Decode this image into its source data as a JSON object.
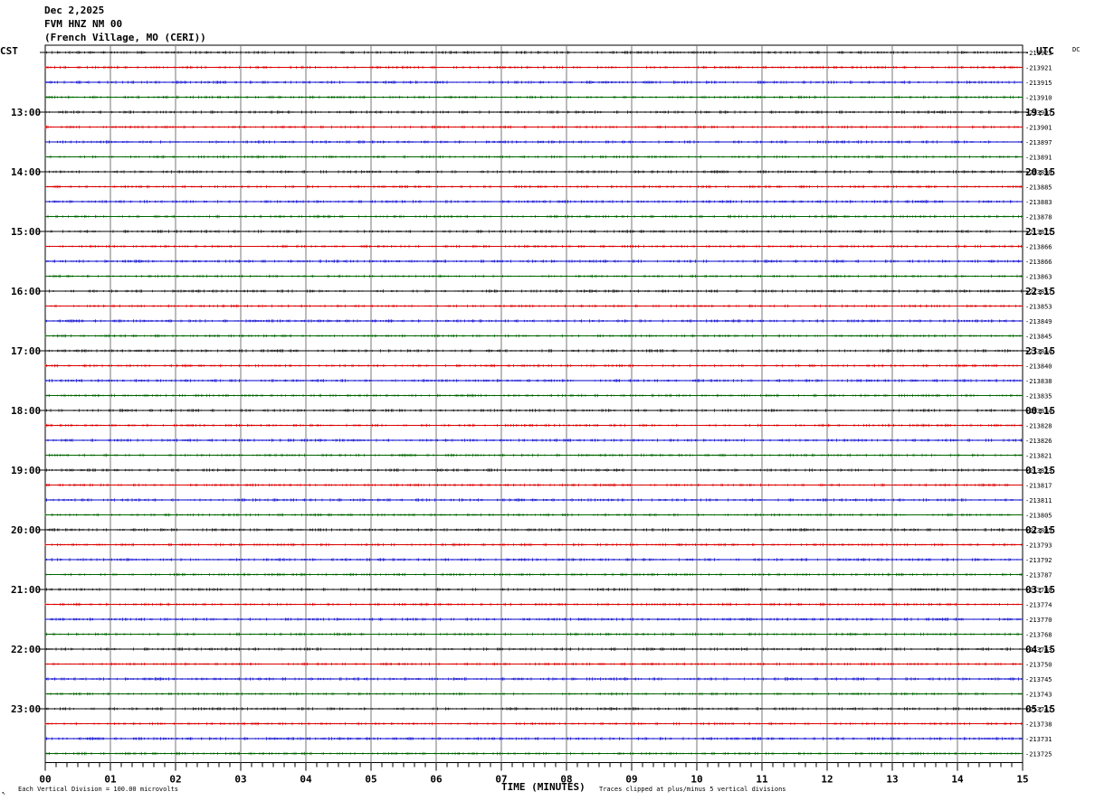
{
  "header": {
    "date": "Dec 2,2025",
    "station": "FVM HNZ NM 00",
    "location": "(French Village, MO (CERI))"
  },
  "left_tz": "CST",
  "right_tz": "UTC",
  "corner_code": "DC",
  "footer": {
    "scale_note": "Each Vertical Division =  100.00 microvolts",
    "xlabel": "TIME (MINUTES)",
    "clip_note": "Traces clipped at plus/minus 5 vertical divisions",
    "mark": "↖"
  },
  "chart_data": {
    "type": "line",
    "xlabel": "TIME (MINUTES)",
    "xlim": [
      0,
      15
    ],
    "x_ticks": [
      "00",
      "01",
      "02",
      "03",
      "04",
      "05",
      "06",
      "07",
      "08",
      "09",
      "10",
      "11",
      "12",
      "13",
      "14",
      "15"
    ],
    "trace_colors": [
      "#000000",
      "#dd0000",
      "#0000cc",
      "#006600"
    ],
    "left_hour_labels": [
      "13:00",
      "14:00",
      "15:00",
      "16:00",
      "17:00",
      "18:00",
      "19:00",
      "20:00",
      "21:00",
      "22:00",
      "23:00"
    ],
    "right_hour_labels": [
      "19:15",
      "20:15",
      "21:15",
      "22:15",
      "23:15",
      "00:15",
      "01:15",
      "02:15",
      "03:15",
      "04:15",
      "05:15"
    ],
    "trace_offsets": [
      "-213923",
      "-213921",
      "-213915",
      "-213910",
      "-213907",
      "-213901",
      "-213897",
      "-213891",
      "-213890",
      "-213885",
      "-213883",
      "-213878",
      "-213871",
      "-213866",
      "-213866",
      "-213863",
      "-213857",
      "-213853",
      "-213849",
      "-213845",
      "-213844",
      "-213840",
      "-213838",
      "-213835",
      "-213834",
      "-213828",
      "-213826",
      "-213821",
      "-213823",
      "-213817",
      "-213811",
      "-213805",
      "-213805",
      "-213793",
      "-213792",
      "-213787",
      "-213780",
      "-213774",
      "-213770",
      "-213768",
      "-213763",
      "-213750",
      "-213745",
      "-213743",
      "-213741",
      "-213738",
      "-213731",
      "-213725"
    ]
  }
}
